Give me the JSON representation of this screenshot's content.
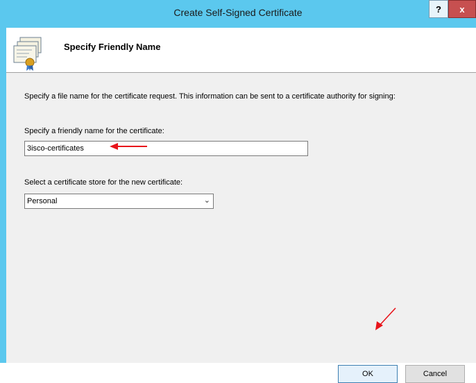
{
  "window": {
    "title": "Create Self-Signed Certificate",
    "help_glyph": "?",
    "close_glyph": "x"
  },
  "header": {
    "title": "Specify Friendly Name",
    "icon": "certificate-icon"
  },
  "body": {
    "description": "Specify a file name for the certificate request.  This information can be sent to a certificate authority for signing:",
    "friendly_name_label": "Specify a friendly name for the certificate:",
    "friendly_name_value": "3isco-certificates",
    "store_label": "Select a certificate store for the new certificate:",
    "store_value": "Personal"
  },
  "buttons": {
    "ok": "OK",
    "cancel": "Cancel"
  },
  "colors": {
    "titlebar": "#5bc8ee",
    "annotation_arrow": "#e8141b"
  }
}
